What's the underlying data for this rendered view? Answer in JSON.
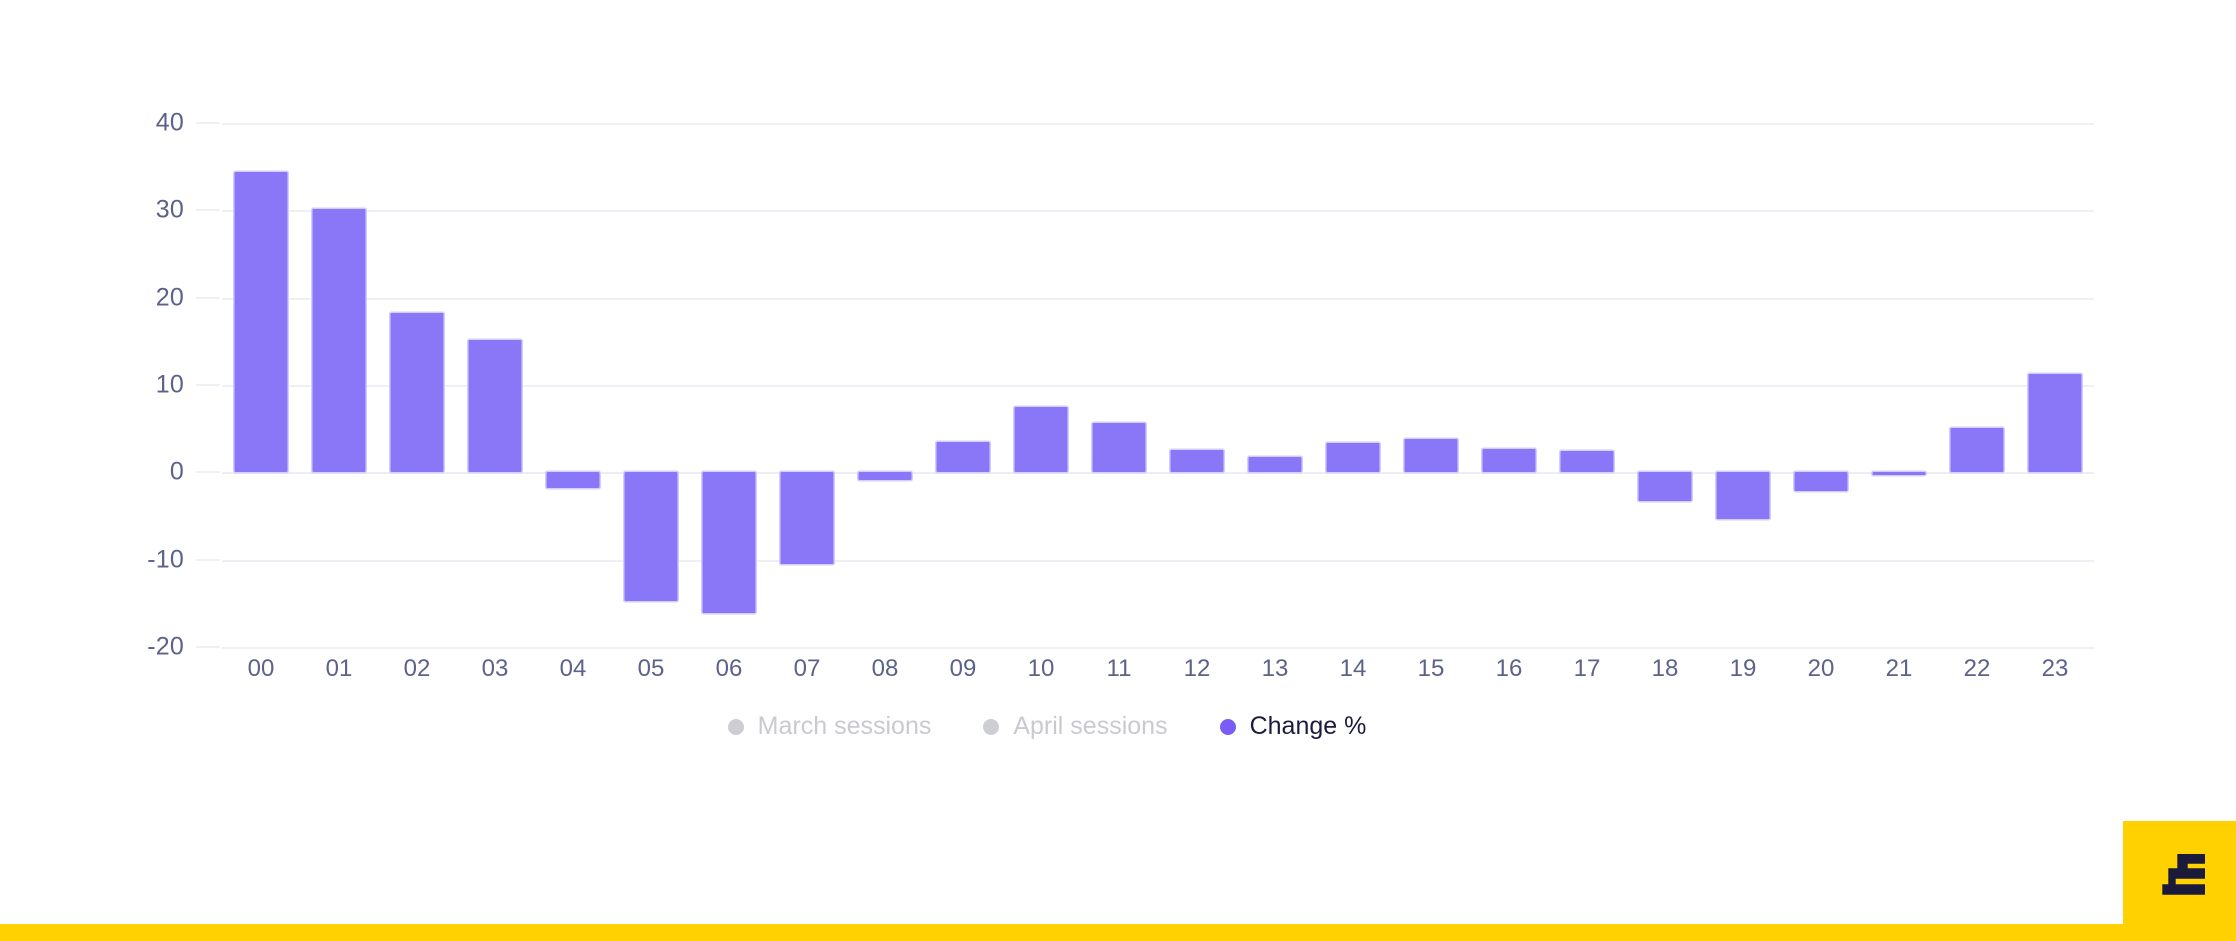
{
  "chart_data": {
    "type": "bar",
    "title": "",
    "subtitle": "",
    "xlabel": "",
    "ylabel": "",
    "categories": [
      "00",
      "01",
      "02",
      "03",
      "04",
      "05",
      "06",
      "07",
      "08",
      "09",
      "10",
      "11",
      "12",
      "13",
      "14",
      "15",
      "16",
      "17",
      "18",
      "19",
      "20",
      "21",
      "22",
      "23"
    ],
    "series": [
      {
        "name": "March sessions",
        "visible": false,
        "color": "#cdcdd4",
        "values": []
      },
      {
        "name": "April sessions",
        "visible": false,
        "color": "#cdcdd4",
        "values": []
      },
      {
        "name": "Change %",
        "visible": true,
        "color": "#8a77f8",
        "values": [
          34.4,
          30.1,
          18.3,
          15.1,
          -1.8,
          -14.7,
          -16.1,
          -10.5,
          -0.9,
          3.5,
          7.5,
          5.7,
          2.6,
          1.7,
          3.4,
          3.8,
          2.7,
          2.5,
          -3.3,
          -5.4,
          -2.1,
          -0.3,
          5.1,
          11.3
        ]
      }
    ],
    "ylim": [
      -20,
      40
    ],
    "yticks": [
      40,
      30,
      20,
      10,
      0,
      -10,
      -20
    ],
    "ytick_labels": [
      "40",
      "30",
      "20",
      "10",
      "0",
      "-10",
      "-20"
    ],
    "grid": true,
    "grid_color": "#eff0f6",
    "legend_position": "bottom",
    "axis_label_color": "#5c6289",
    "zero_line": 0
  },
  "legend": {
    "items": [
      {
        "label": "March sessions",
        "state": "off"
      },
      {
        "label": "April sessions",
        "state": "off"
      },
      {
        "label": "Change %",
        "state": "on"
      }
    ]
  },
  "branding": {
    "accent_color": "#ffd100",
    "glyph_color": "#1b1a3a",
    "logo_name": "stair-step-e-logo"
  }
}
